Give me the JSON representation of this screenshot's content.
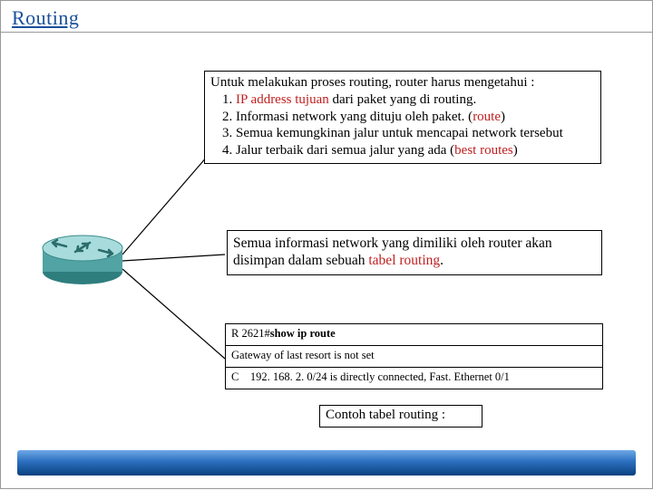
{
  "title": "Routing",
  "box1": {
    "intro": "Untuk melakukan proses routing, router harus mengetahui :",
    "items": [
      {
        "pre": "",
        "hl": "IP address tujuan",
        "post": " dari paket yang di routing."
      },
      {
        "pre": "Informasi network yang dituju oleh paket. (",
        "hl": "route",
        "post": ")"
      },
      {
        "pre": "Semua kemungkinan jalur untuk mencapai network tersebut",
        "hl": "",
        "post": ""
      },
      {
        "pre": "Jalur terbaik dari semua jalur yang ada (",
        "hl": "best routes",
        "post": ")"
      }
    ]
  },
  "box2": {
    "pre": "Semua informasi network yang dimiliki oleh router akan disimpan dalam sebuah ",
    "hl": "tabel routing",
    "post": "."
  },
  "box3": {
    "prompt": "R 2621#",
    "cmd": "show ip route",
    "line2": "Gateway of last resort is not set",
    "line3_code": "C",
    "line3_text": "192. 168. 2. 0/24 is directly connected, Fast. Ethernet 0/1"
  },
  "box4": {
    "text": "Contoh tabel routing :"
  }
}
